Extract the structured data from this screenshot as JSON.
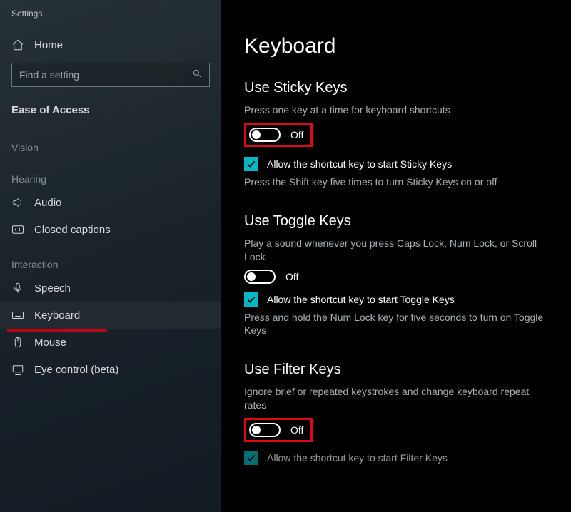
{
  "window": {
    "title": "Settings"
  },
  "sidebar": {
    "home": "Home",
    "search_placeholder": "Find a setting",
    "category": "Ease of Access",
    "groups": {
      "vision": {
        "label": "Vision"
      },
      "hearing": {
        "label": "Hearing",
        "items": [
          {
            "id": "audio",
            "label": "Audio"
          },
          {
            "id": "closed-captions",
            "label": "Closed captions"
          }
        ]
      },
      "interaction": {
        "label": "Interaction",
        "items": [
          {
            "id": "speech",
            "label": "Speech"
          },
          {
            "id": "keyboard",
            "label": "Keyboard",
            "selected": true
          },
          {
            "id": "mouse",
            "label": "Mouse"
          },
          {
            "id": "eye-control",
            "label": "Eye control (beta)"
          }
        ]
      }
    }
  },
  "page": {
    "title": "Keyboard",
    "sticky": {
      "heading": "Use Sticky Keys",
      "desc": "Press one key at a time for keyboard shortcuts",
      "toggle_state": "Off",
      "shortcut_label": "Allow the shortcut key to start Sticky Keys",
      "shortcut_desc": "Press the Shift key five times to turn Sticky Keys on or off"
    },
    "toggle": {
      "heading": "Use Toggle Keys",
      "desc": "Play a sound whenever you press Caps Lock, Num Lock, or Scroll Lock",
      "toggle_state": "Off",
      "shortcut_label": "Allow the shortcut key to start Toggle Keys",
      "shortcut_desc": "Press and hold the Num Lock key for five seconds to turn on Toggle Keys"
    },
    "filter": {
      "heading": "Use Filter Keys",
      "desc": "Ignore brief or repeated keystrokes and change keyboard repeat rates",
      "toggle_state": "Off",
      "shortcut_label": "Allow the shortcut key to start Filter Keys"
    }
  }
}
